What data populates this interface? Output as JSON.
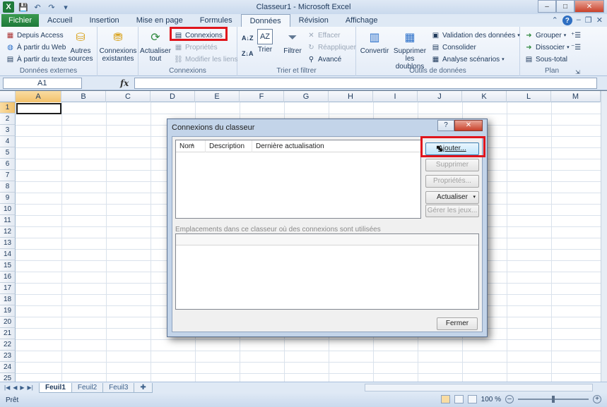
{
  "window": {
    "title": "Classeur1 - Microsoft Excel",
    "controls": [
      "–",
      "□",
      "✕"
    ]
  },
  "tabs": [
    {
      "label": "Fichier"
    },
    {
      "label": "Accueil"
    },
    {
      "label": "Insertion"
    },
    {
      "label": "Mise en page"
    },
    {
      "label": "Formules"
    },
    {
      "label": "Données"
    },
    {
      "label": "Révision"
    },
    {
      "label": "Affichage"
    }
  ],
  "ribbon": {
    "external": {
      "label": "Données externes",
      "access": "Depuis Access",
      "web": "À partir du Web",
      "text": "À partir du texte",
      "other_line1": "Autres",
      "other_line2": "sources",
      "existing_line1": "Connexions",
      "existing_line2": "existantes"
    },
    "connections": {
      "label": "Connexions",
      "refresh_line1": "Actualiser",
      "refresh_line2": "tout",
      "connexions": "Connexions",
      "properties": "Propriétés",
      "edit_links": "Modifier les liens"
    },
    "sort_filter": {
      "label": "Trier et filtrer",
      "sort": "Trier",
      "filter": "Filtrer",
      "clear": "Effacer",
      "reapply": "Réappliquer",
      "advanced": "Avancé"
    },
    "data_tools": {
      "label": "Outils de données",
      "convert": "Convertir",
      "dedupe_line1": "Supprimer",
      "dedupe_line2": "les doublons",
      "validation": "Validation des données",
      "consolidate": "Consolider",
      "whatif": "Analyse scénarios"
    },
    "outline": {
      "label": "Plan",
      "group": "Grouper",
      "ungroup": "Dissocier",
      "subtotal": "Sous-total"
    }
  },
  "formula_bar": {
    "name_box": "A1",
    "fx": "fx",
    "formula": ""
  },
  "grid": {
    "columns": [
      "A",
      "B",
      "C",
      "D",
      "E",
      "F",
      "G",
      "H",
      "I",
      "J",
      "K",
      "L",
      "M"
    ],
    "rows": [
      "1",
      "2",
      "3",
      "4",
      "5",
      "6",
      "7",
      "8",
      "9",
      "10",
      "11",
      "12",
      "13",
      "14",
      "15",
      "16",
      "17",
      "18",
      "19",
      "20",
      "21",
      "22",
      "23",
      "24",
      "25"
    ]
  },
  "sheets": [
    "Feuil1",
    "Feuil2",
    "Feuil3"
  ],
  "status": {
    "text": "Prêt",
    "zoom": "100 %"
  },
  "dialog": {
    "title": "Connexions du classeur",
    "help": "?",
    "close": "✕",
    "columns": [
      "Nom",
      "Description",
      "Dernière actualisation"
    ],
    "buttons": {
      "add": "Ajouter...",
      "remove": "Supprimer",
      "properties": "Propriétés...",
      "refresh": "Actualiser",
      "manage_sets": "Gérer les jeux...",
      "close": "Fermer"
    },
    "locations_label": "Emplacements dans ce classeur où des connexions sont utilisées"
  },
  "colors": {
    "highlight_frame": "#e0151c",
    "file_tab": "#1f7a3a"
  }
}
